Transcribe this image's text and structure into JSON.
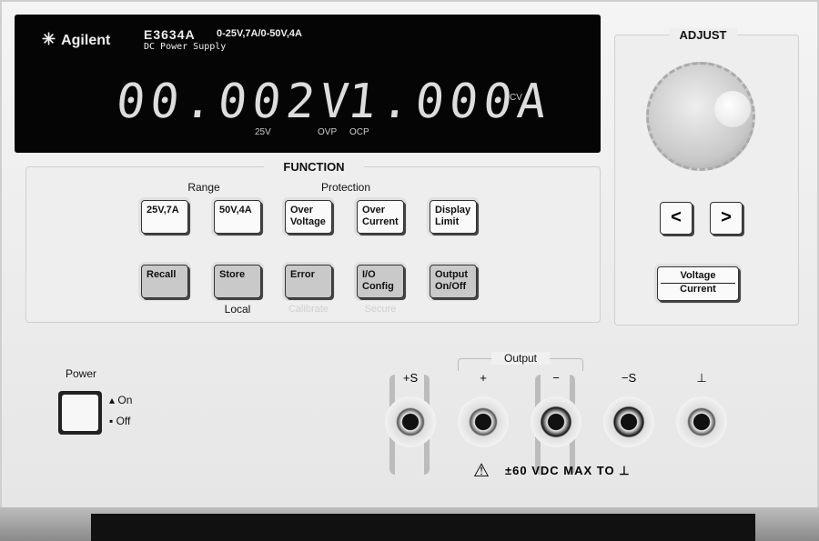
{
  "display": {
    "brand": "Agilent",
    "model": "E3634A",
    "subtitle": "DC Power Supply",
    "ratings": "0-25V,7A/0-50V,4A",
    "voltage_reading": "00.002V",
    "current_reading": "1.000A",
    "mode_annunciator": "CV",
    "annunciators": [
      "25V",
      "OVP",
      "OCP"
    ]
  },
  "function": {
    "title": "FUNCTION",
    "range_label": "Range",
    "protection_label": "Protection",
    "row1": [
      "25V,7A",
      "50V,4A",
      "Over Voltage",
      "Over Current",
      "Display Limit"
    ],
    "row2": [
      "Recall",
      "Store",
      "Error",
      "I/O Config",
      "Output On/Off"
    ],
    "shifted": [
      "Local",
      "Calibrate",
      "Secure"
    ]
  },
  "adjust": {
    "title": "ADJUST",
    "left_arrow": "<",
    "right_arrow": ">",
    "voltage": "Voltage",
    "current": "Current"
  },
  "power": {
    "label": "Power",
    "on": "On",
    "off": "Off"
  },
  "output": {
    "label": "Output",
    "terminals": [
      "+S",
      "+",
      "−",
      "−S",
      "⊥"
    ],
    "warning": "±60 VDC MAX TO ⊥"
  }
}
